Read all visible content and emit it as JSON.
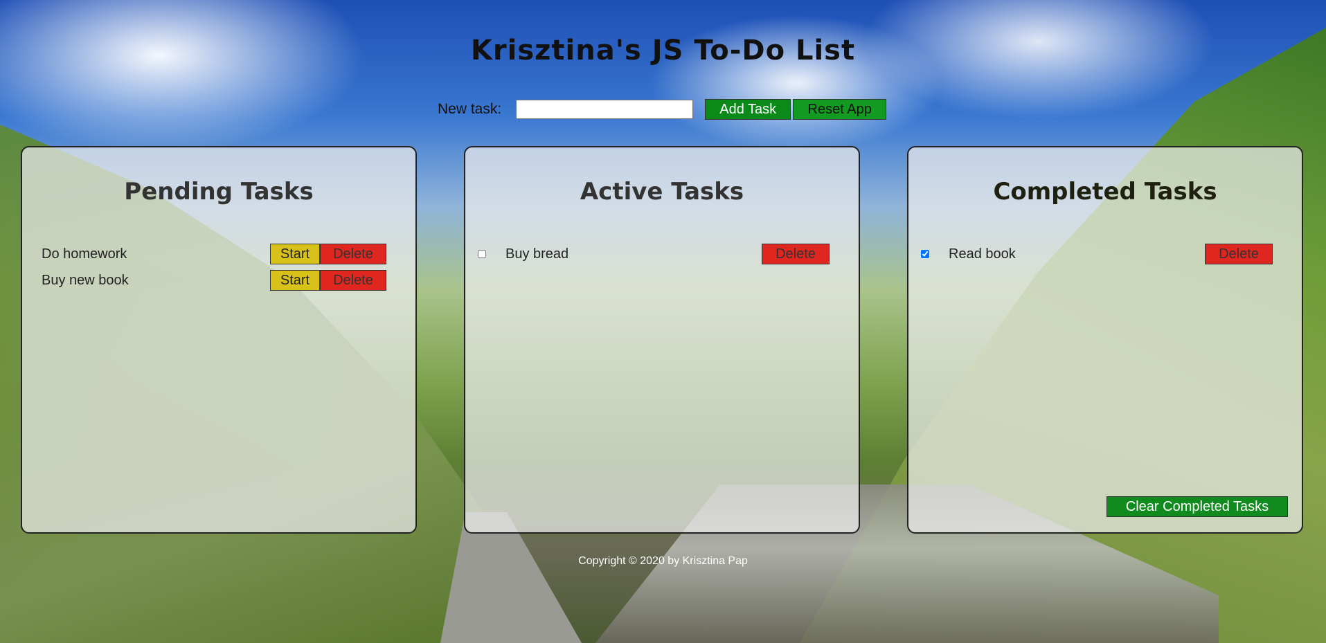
{
  "app": {
    "title": "Krisztina's JS To-Do List"
  },
  "new_task": {
    "label": "New task:",
    "value": "",
    "add_label": "Add Task",
    "reset_label": "Reset App"
  },
  "pending": {
    "heading": "Pending Tasks",
    "tasks": [
      {
        "text": "Do homework",
        "start_label": "Start",
        "delete_label": "Delete"
      },
      {
        "text": "Buy new book",
        "start_label": "Start",
        "delete_label": "Delete"
      }
    ]
  },
  "active": {
    "heading": "Active Tasks",
    "tasks": [
      {
        "text": "Buy bread",
        "checked": false,
        "delete_label": "Delete"
      }
    ]
  },
  "completed": {
    "heading": "Completed Tasks",
    "tasks": [
      {
        "text": "Read book",
        "checked": true,
        "delete_label": "Delete"
      }
    ],
    "clear_label": "Clear Completed Tasks"
  },
  "footer": {
    "text": "Copyright © 2020 by Krisztina Pap"
  },
  "colors": {
    "add_button": "#0b8a1a",
    "start_button": "#d8c21a",
    "delete_button": "#e0271f"
  }
}
